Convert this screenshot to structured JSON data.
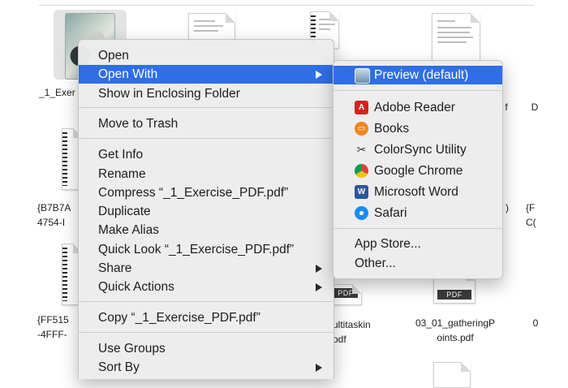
{
  "files": [
    {
      "label": "_1_Exer",
      "type": "photo",
      "selected": true
    },
    {
      "label": "",
      "type": "doc"
    },
    {
      "label": "",
      "type": "spiral"
    },
    {
      "label": "",
      "type": "doc"
    },
    {
      "label_line1": "{B7B7A",
      "label_line2": "4754-I",
      "type": "spiral"
    },
    {
      "label_line1": "{FF515",
      "label_line2": "-4FFF-",
      "type": "spiral"
    },
    {
      "label_line1": "ultitaskin",
      "label_line2": "odf",
      "type": "spiral"
    },
    {
      "label_line1": "03_01_gatheringP",
      "label_line2": "oints.pdf",
      "type": "pdf",
      "chip": "PDF"
    },
    {
      "label": "f",
      "type": "partial"
    },
    {
      "label": "D",
      "type": "partial"
    },
    {
      "label": ")",
      "type": "partial"
    },
    {
      "label_line1": "{F",
      "label_line2": "C(",
      "type": "partial"
    },
    {
      "label": "0",
      "type": "partial"
    },
    {
      "label": "PDF",
      "type": "chip"
    }
  ],
  "context_menu": {
    "items": [
      {
        "label": "Open"
      },
      {
        "label": "Open With",
        "highlighted": true,
        "submenu": true
      },
      {
        "label": "Show in Enclosing Folder"
      },
      {
        "label": "Move to Trash"
      },
      {
        "label": "Get Info"
      },
      {
        "label": "Rename"
      },
      {
        "label": "Compress “_1_Exercise_PDF.pdf”"
      },
      {
        "label": "Duplicate"
      },
      {
        "label": "Make Alias"
      },
      {
        "label": "Quick Look “_1_Exercise_PDF.pdf”"
      },
      {
        "label": "Share",
        "submenu": true
      },
      {
        "label": "Quick Actions",
        "submenu": true
      },
      {
        "label": "Copy “_1_Exercise_PDF.pdf”"
      },
      {
        "label": "Use Groups"
      },
      {
        "label": "Sort By",
        "submenu": true
      }
    ]
  },
  "open_with_menu": {
    "items": [
      {
        "label": "Preview (default)",
        "icon": "preview-icon",
        "highlighted": true
      },
      {
        "label": "Adobe Reader",
        "icon": "adobe-reader-icon",
        "color": "#d4231d"
      },
      {
        "label": "Books",
        "icon": "books-icon",
        "color": "#f0861e"
      },
      {
        "label": "ColorSync Utility",
        "icon": "colorsync-utility-icon"
      },
      {
        "label": "Google Chrome",
        "icon": "google-chrome-icon"
      },
      {
        "label": "Microsoft Word",
        "icon": "microsoft-word-icon",
        "color": "#2b579a"
      },
      {
        "label": "Safari",
        "icon": "safari-icon",
        "color": "#1a8cf0"
      },
      {
        "label": "App Store..."
      },
      {
        "label": "Other..."
      }
    ]
  },
  "colors": {
    "highlight": "#2f6ee6",
    "menu_bg": "#ececec"
  }
}
